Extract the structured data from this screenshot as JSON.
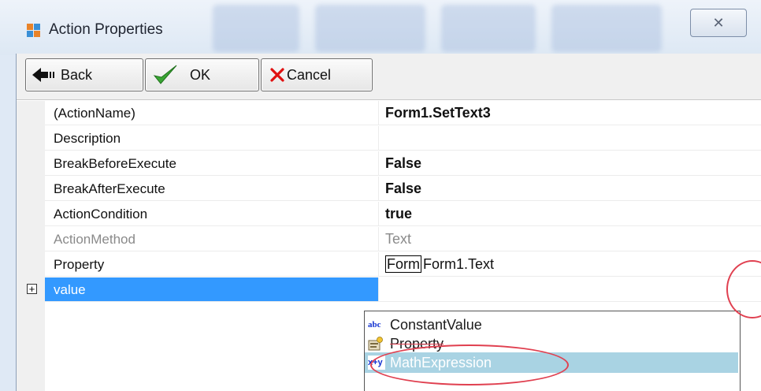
{
  "window": {
    "title": "Action Properties",
    "close_glyph": "✕"
  },
  "toolbar": {
    "back_label": "Back",
    "ok_label": "OK",
    "cancel_label": "Cancel"
  },
  "properties": [
    {
      "name": "(ActionName)",
      "value": "Form1.SetText3"
    },
    {
      "name": "Description",
      "value": ""
    },
    {
      "name": "BreakBeforeExecute",
      "value": "False"
    },
    {
      "name": "BreakAfterExecute",
      "value": "False"
    },
    {
      "name": "ActionCondition",
      "value": "true"
    },
    {
      "name": "ActionMethod",
      "value": "Text"
    },
    {
      "name": "Property",
      "value": "Form1.Text",
      "prefix": "Form"
    },
    {
      "name": "value",
      "value": ""
    }
  ],
  "value_dropdown": {
    "items": [
      {
        "icon_text": "abc",
        "label": "ConstantValue"
      },
      {
        "icon_text": "",
        "label": "Property"
      },
      {
        "icon_text": "x+y",
        "label": "MathExpression"
      }
    ],
    "selected_index": 2
  },
  "colors": {
    "selection": "#3399ff",
    "dropdown_highlight": "#a9d3e3",
    "annotation": "#e04050"
  }
}
